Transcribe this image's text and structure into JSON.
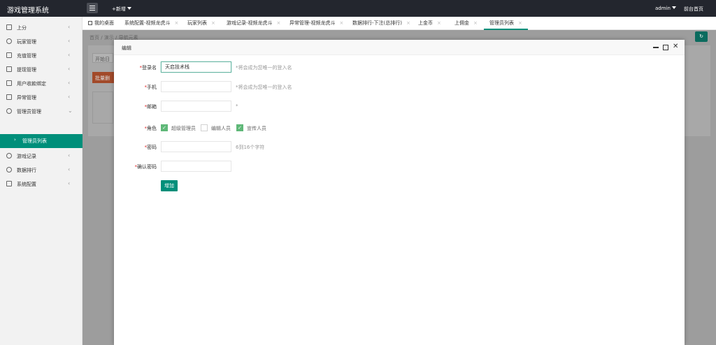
{
  "app": {
    "title": "游戏管理系统",
    "add_new": "+新增",
    "user": "admin",
    "front_page": "前台首页"
  },
  "sidebar": {
    "items": [
      {
        "label": "上分"
      },
      {
        "label": "玩家管理"
      },
      {
        "label": "充值管理"
      },
      {
        "label": "提现管理"
      },
      {
        "label": "用户收款绑定"
      },
      {
        "label": "异常管理"
      },
      {
        "label": "管理员管理"
      },
      {
        "label": "游戏记录"
      },
      {
        "label": "数据排行"
      },
      {
        "label": "系统配置"
      }
    ],
    "active_sub": "管理员列表"
  },
  "tabs": [
    {
      "label": "我的桌面"
    },
    {
      "label": "系统配置-视频龙虎斗"
    },
    {
      "label": "玩家列表"
    },
    {
      "label": "游戏记录-视频龙虎斗"
    },
    {
      "label": "异常管理-视频龙虎斗"
    },
    {
      "label": "数据排行-下注(总排行)"
    },
    {
      "label": "上金币"
    },
    {
      "label": "上佣金"
    },
    {
      "label": "管理员列表"
    }
  ],
  "breadcrumb": "首页 / 演示 / 导航元素",
  "background": {
    "field": "开始日",
    "batch_btn": "批量删"
  },
  "dialog": {
    "title": "编辑",
    "fields": {
      "username": {
        "label": "登录名",
        "value": "天启技术栈",
        "hint": "*将会成为您唯一的登入名"
      },
      "phone": {
        "label": "手机",
        "value": "",
        "hint": "*将会成为您唯一的登入名"
      },
      "email": {
        "label": "邮箱",
        "value": "",
        "hint": "*"
      },
      "role": {
        "label": "角色",
        "options": [
          {
            "label": "超级管理员",
            "checked": true
          },
          {
            "label": "编辑人员",
            "checked": false
          },
          {
            "label": "宣传人员",
            "checked": true
          }
        ]
      },
      "password": {
        "label": "密码",
        "value": "",
        "hint": "6到16个字符"
      },
      "confirm": {
        "label": "确认密码",
        "value": ""
      }
    },
    "submit": "增加"
  },
  "colors": {
    "accent": "#008f7a",
    "check": "#5fb878",
    "topbar": "#23262e"
  }
}
